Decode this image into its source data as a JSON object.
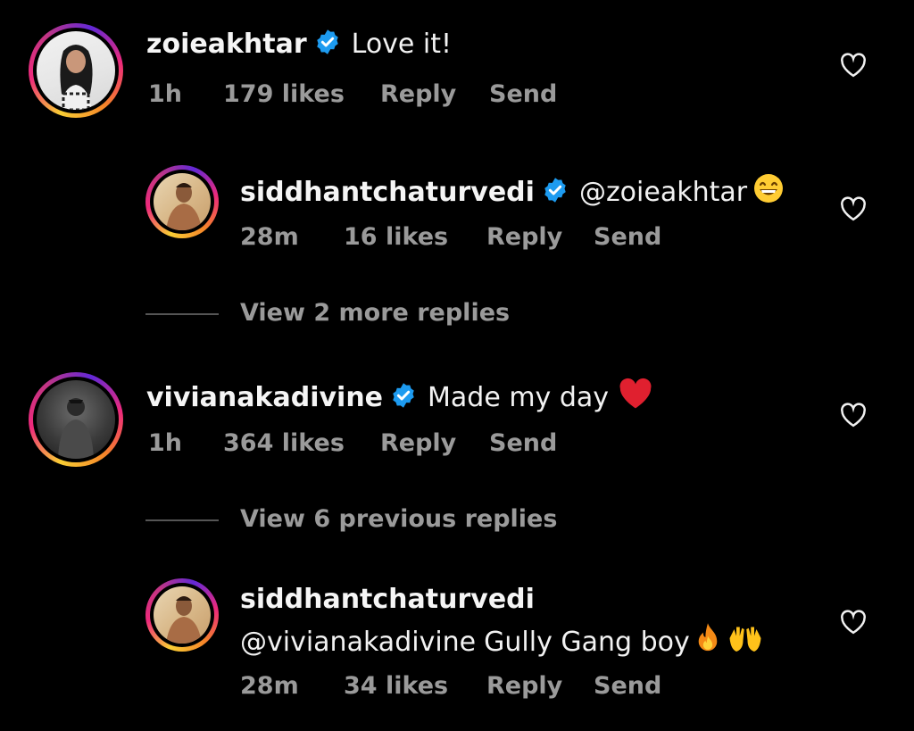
{
  "comments": [
    {
      "username": "zoieakhtar",
      "verified": true,
      "text": "Love it!",
      "time": "1h",
      "likes": "179 likes",
      "reply": "Reply",
      "send": "Send"
    },
    {
      "username": "siddhantchaturvedi",
      "verified": true,
      "mention": "@zoieakhtar",
      "time": "28m",
      "likes": "16 likes",
      "reply": "Reply",
      "send": "Send"
    },
    {
      "username": "vivianakadivine",
      "verified": true,
      "text": "Made my day",
      "time": "1h",
      "likes": "364 likes",
      "reply": "Reply",
      "send": "Send"
    },
    {
      "username": "siddhantchaturvedi",
      "verified": false,
      "mention": "@vivianakadivine",
      "text": "Gully Gang boy",
      "time": "28m",
      "likes": "34 likes",
      "reply": "Reply",
      "send": "Send"
    }
  ],
  "threads": {
    "more_replies": "View 2 more replies",
    "previous_replies": "View 6 previous replies"
  },
  "colors": {
    "background": "#000000",
    "text": "#f5f5f5",
    "meta": "#9a9a9a",
    "verified_badge": "#1d9bf0"
  },
  "icons": [
    "verified-badge-icon",
    "heart-outline-icon",
    "grinning-emoji-icon",
    "red-heart-emoji-icon",
    "fire-emoji-icon",
    "raising-hands-emoji-icon"
  ]
}
